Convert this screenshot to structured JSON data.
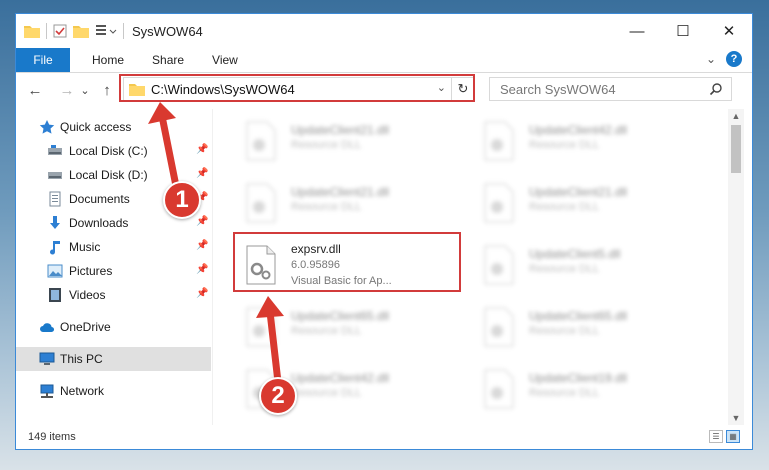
{
  "window": {
    "title": "SysWOW64",
    "controls": {
      "minimize": "—",
      "maximize": "☐",
      "close": "✕"
    }
  },
  "ribbon": {
    "tabs": [
      "File",
      "Home",
      "Share",
      "View"
    ],
    "collapse_glyph": "⌄",
    "help_glyph": "?"
  },
  "nav": {
    "back": "←",
    "forward": "→",
    "recent": "⌄",
    "up": "↑",
    "address": "C:\\Windows\\SysWOW64",
    "dropdown": "⌄",
    "refresh": "↻",
    "search_placeholder": "Search SysWOW64"
  },
  "sidebar": {
    "items": [
      {
        "label": "Quick access",
        "icon": "star-icon",
        "pinned": false
      },
      {
        "label": "Local Disk (C:)",
        "icon": "drive-icon",
        "pinned": true
      },
      {
        "label": "Local Disk (D:)",
        "icon": "drive-icon",
        "pinned": true
      },
      {
        "label": "Documents",
        "icon": "documents-icon",
        "pinned": true
      },
      {
        "label": "Downloads",
        "icon": "download-icon",
        "pinned": true
      },
      {
        "label": "Music",
        "icon": "music-icon",
        "pinned": true
      },
      {
        "label": "Pictures",
        "icon": "pictures-icon",
        "pinned": true
      },
      {
        "label": "Videos",
        "icon": "videos-icon",
        "pinned": true
      },
      {
        "label": "OneDrive",
        "icon": "cloud-icon",
        "pinned": false
      },
      {
        "label": "This PC",
        "icon": "computer-icon",
        "pinned": false,
        "selected": true
      },
      {
        "label": "Network",
        "icon": "network-icon",
        "pinned": false
      }
    ],
    "pin_glyph": "📌"
  },
  "files": [
    {
      "name": "UpdateClient21.dll",
      "desc": "Resource DLL",
      "blurred": true
    },
    {
      "name": "UpdateClient42.dll",
      "desc": "Resource DLL",
      "blurred": true
    },
    {
      "name": "UpdateClient21.dll",
      "desc": "Resource DLL",
      "blurred": true
    },
    {
      "name": "UpdateClient21.dll",
      "desc": "Resource DLL",
      "blurred": true
    },
    {
      "name": "expsrv.dll",
      "desc": "6.0.95896",
      "desc2": "Visual Basic for Ap...",
      "blurred": false
    },
    {
      "name": "UpdateClient5.dll",
      "desc": "Resource DLL",
      "blurred": true
    },
    {
      "name": "UpdateClient65.dll",
      "desc": "Resource DLL",
      "blurred": true
    },
    {
      "name": "UpdateClient65.dll",
      "desc": "Resource DLL",
      "blurred": true
    },
    {
      "name": "UpdateClient42.dll",
      "desc": "Resource DLL",
      "blurred": true
    },
    {
      "name": "UpdateClient19.dll",
      "desc": "Resource DLL",
      "blurred": true
    }
  ],
  "status": {
    "item_count": "149 items"
  },
  "annotations": {
    "step1": "1",
    "step2": "2"
  },
  "colors": {
    "accent": "#1979ca",
    "annotation": "#d9392f"
  }
}
